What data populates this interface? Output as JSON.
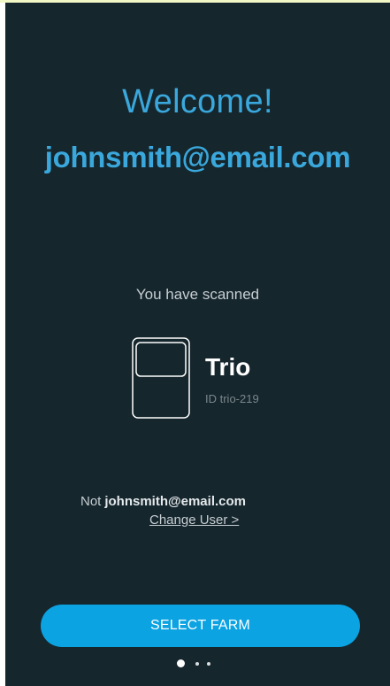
{
  "welcome": {
    "title": "Welcome!",
    "email": "johnsmith@email.com"
  },
  "scan": {
    "caption": "You have scanned",
    "device_name": "Trio",
    "device_id": "ID trio-219",
    "device_icon": "device-icon"
  },
  "user": {
    "not_prefix": "Not",
    "email": "johnsmith@email.com",
    "change_user_link": "Change User >"
  },
  "actions": {
    "select_farm_label": "SELECT FARM"
  },
  "pager": {
    "page_count": 3,
    "current_page": 1
  },
  "colors": {
    "background": "#16262d",
    "accent": "#3aa8dc",
    "button": "#0ba3e2"
  }
}
